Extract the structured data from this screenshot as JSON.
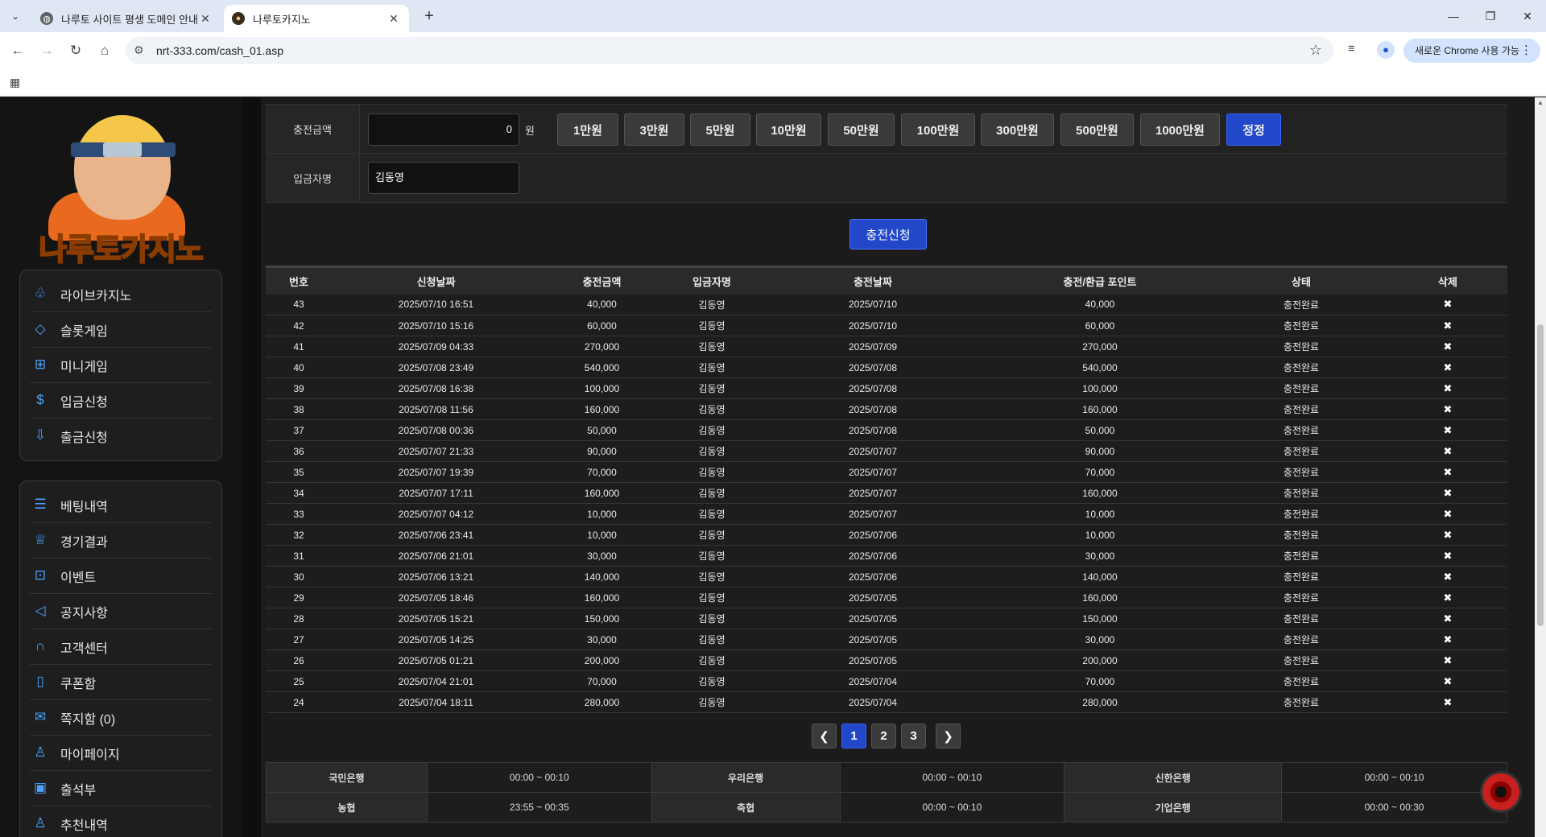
{
  "browser": {
    "tabs": [
      {
        "title": "나루토 사이트 평생 도메인 안내"
      },
      {
        "title": "나루토카지노"
      }
    ],
    "url": "nrt-333.com/cash_01.asp",
    "chrome_pill": "새로운 Chrome 사용 가능"
  },
  "sidebar": {
    "logo_text": "나루토카지노",
    "group1": [
      {
        "label": "라이브카지노",
        "icon": "casino-icon"
      },
      {
        "label": "슬롯게임",
        "icon": "diamond-icon"
      },
      {
        "label": "미니게임",
        "icon": "gamepad-icon"
      },
      {
        "label": "입금신청",
        "icon": "deposit-icon"
      },
      {
        "label": "출금신청",
        "icon": "withdraw-icon"
      }
    ],
    "group2": [
      {
        "label": "베팅내역",
        "icon": "list-icon"
      },
      {
        "label": "경기결과",
        "icon": "trophy-icon"
      },
      {
        "label": "이벤트",
        "icon": "gift-icon"
      },
      {
        "label": "공지사항",
        "icon": "megaphone-icon"
      },
      {
        "label": "고객센터",
        "icon": "headset-icon"
      },
      {
        "label": "쿠폰함",
        "icon": "coupon-icon"
      },
      {
        "label": "쪽지함 (0)",
        "icon": "mail-icon"
      },
      {
        "label": "마이페이지",
        "icon": "user-icon"
      },
      {
        "label": "출석부",
        "icon": "calendar-icon"
      },
      {
        "label": "추천내역",
        "icon": "user-plus-icon"
      }
    ]
  },
  "form": {
    "amount_label": "충전금액",
    "amount_value": "0",
    "won": "원",
    "amount_buttons": [
      "1만원",
      "3만원",
      "5만원",
      "10만원",
      "50만원",
      "100만원",
      "300만원",
      "500만원",
      "1000만원"
    ],
    "reset_button": "정정",
    "depositor_label": "입금자명",
    "depositor_value": "김동영",
    "submit": "충전신청"
  },
  "table": {
    "headers": [
      "번호",
      "신청날짜",
      "충전금액",
      "입금자명",
      "충전날짜",
      "충전/환급 포인트",
      "상태",
      "삭제"
    ],
    "rows": [
      [
        "43",
        "2025/07/10 16:51",
        "40,000",
        "김동영",
        "2025/07/10",
        "40,000",
        "충전완료"
      ],
      [
        "42",
        "2025/07/10 15:16",
        "60,000",
        "김동영",
        "2025/07/10",
        "60,000",
        "충전완료"
      ],
      [
        "41",
        "2025/07/09 04:33",
        "270,000",
        "김동영",
        "2025/07/09",
        "270,000",
        "충전완료"
      ],
      [
        "40",
        "2025/07/08 23:49",
        "540,000",
        "김동영",
        "2025/07/08",
        "540,000",
        "충전완료"
      ],
      [
        "39",
        "2025/07/08 16:38",
        "100,000",
        "김동영",
        "2025/07/08",
        "100,000",
        "충전완료"
      ],
      [
        "38",
        "2025/07/08 11:56",
        "160,000",
        "김동영",
        "2025/07/08",
        "160,000",
        "충전완료"
      ],
      [
        "37",
        "2025/07/08 00:36",
        "50,000",
        "김동영",
        "2025/07/08",
        "50,000",
        "충전완료"
      ],
      [
        "36",
        "2025/07/07 21:33",
        "90,000",
        "김동영",
        "2025/07/07",
        "90,000",
        "충전완료"
      ],
      [
        "35",
        "2025/07/07 19:39",
        "70,000",
        "김동영",
        "2025/07/07",
        "70,000",
        "충전완료"
      ],
      [
        "34",
        "2025/07/07 17:11",
        "160,000",
        "김동영",
        "2025/07/07",
        "160,000",
        "충전완료"
      ],
      [
        "33",
        "2025/07/07 04:12",
        "10,000",
        "김동영",
        "2025/07/07",
        "10,000",
        "충전완료"
      ],
      [
        "32",
        "2025/07/06 23:41",
        "10,000",
        "김동영",
        "2025/07/06",
        "10,000",
        "충전완료"
      ],
      [
        "31",
        "2025/07/06 21:01",
        "30,000",
        "김동영",
        "2025/07/06",
        "30,000",
        "충전완료"
      ],
      [
        "30",
        "2025/07/06 13:21",
        "140,000",
        "김동영",
        "2025/07/06",
        "140,000",
        "충전완료"
      ],
      [
        "29",
        "2025/07/05 18:46",
        "160,000",
        "김동영",
        "2025/07/05",
        "160,000",
        "충전완료"
      ],
      [
        "28",
        "2025/07/05 15:21",
        "150,000",
        "김동영",
        "2025/07/05",
        "150,000",
        "충전완료"
      ],
      [
        "27",
        "2025/07/05 14:25",
        "30,000",
        "김동영",
        "2025/07/05",
        "30,000",
        "충전완료"
      ],
      [
        "26",
        "2025/07/05 01:21",
        "200,000",
        "김동영",
        "2025/07/05",
        "200,000",
        "충전완료"
      ],
      [
        "25",
        "2025/07/04 21:01",
        "70,000",
        "김동영",
        "2025/07/04",
        "70,000",
        "충전완료"
      ],
      [
        "24",
        "2025/07/04 18:11",
        "280,000",
        "김동영",
        "2025/07/04",
        "280,000",
        "충전완료"
      ]
    ],
    "delete_glyph": "✖"
  },
  "pagination": {
    "prev": "❮",
    "pages": [
      "1",
      "2",
      "3"
    ],
    "current": "1",
    "next": "❯"
  },
  "banks": [
    [
      {
        "name": "국민은행",
        "time": "00:00 ~ 00:10"
      },
      {
        "name": "우리은행",
        "time": "00:00 ~ 00:10"
      },
      {
        "name": "신한은행",
        "time": "00:00 ~ 00:10"
      }
    ],
    [
      {
        "name": "농협",
        "time": "23:55 ~ 00:35"
      },
      {
        "name": "축협",
        "time": "00:00 ~ 00:10"
      },
      {
        "name": "기업은행",
        "time": "00:00 ~ 00:30"
      }
    ]
  ],
  "colors": {
    "accent": "#2247c9",
    "sidebar_icon": "#4aa3ff",
    "background": "#1b1b1b"
  }
}
